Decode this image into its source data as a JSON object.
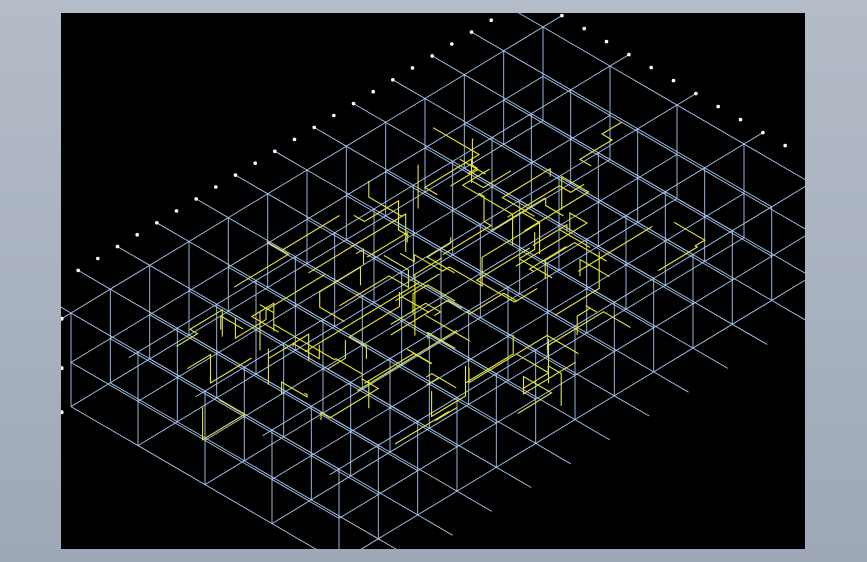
{
  "app": {
    "background_color": "#aab3c0",
    "viewport_color": "#000000"
  },
  "drawing": {
    "grid_color": "#a9c8f0",
    "pipe_color": "#e6e63c",
    "marker_color": "#ffffff"
  }
}
